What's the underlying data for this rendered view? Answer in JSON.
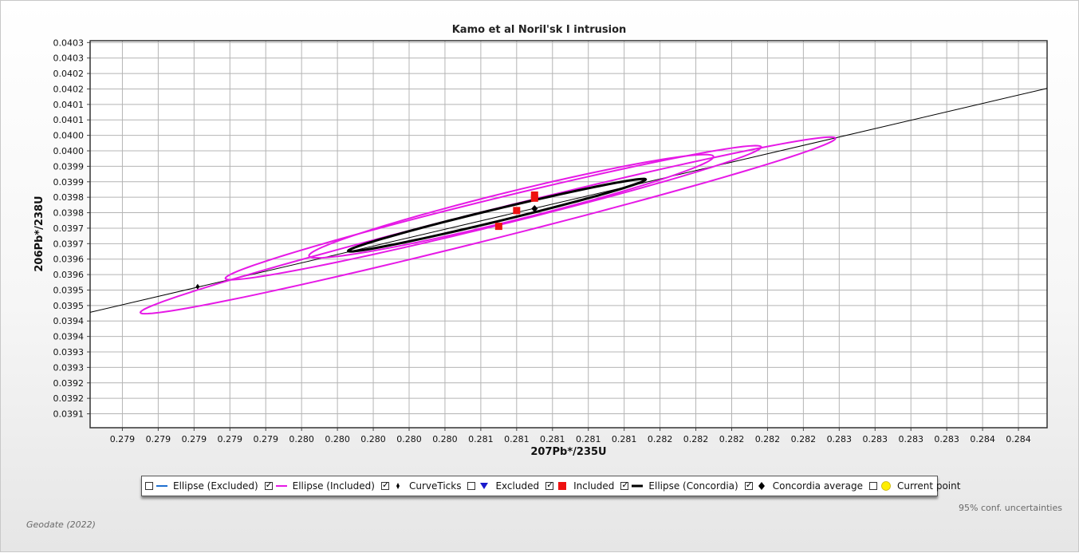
{
  "colors": {
    "ellipse_included": "#e619e6",
    "ellipse_excluded": "#1e6fd0",
    "ellipse_concordia": "#000000",
    "included_marker": "#ee1111",
    "excluded_marker": "#1a1acc",
    "current_point": "#ffee00",
    "concordia_line": "#000000",
    "grid": "#b4b4b4"
  },
  "chart_data": {
    "type": "scatter",
    "title": "Kamo et al Noril'sk I intrusion",
    "xlabel": "207Pb*/235U",
    "ylabel": "206Pb*/238U",
    "xlim": [
      0.27872,
      0.28406
    ],
    "ylim": [
      0.039065,
      0.040316
    ],
    "grid": true,
    "x_tick_values": [
      0.2789,
      0.2791,
      0.2793,
      0.2795,
      0.2797,
      0.2799,
      0.2801,
      0.2803,
      0.2805,
      0.2807,
      0.2809,
      0.2811,
      0.2813,
      0.2815,
      0.2817,
      0.2819,
      0.2821,
      0.2823,
      0.2825,
      0.2827,
      0.2829,
      0.2831,
      0.2833,
      0.2835,
      0.2837,
      0.2839
    ],
    "x_tick_labels": [
      "0.279",
      "0.279",
      "0.279",
      "0.279",
      "0.279",
      "0.280",
      "0.280",
      "0.280",
      "0.280",
      "0.280",
      "0.281",
      "0.281",
      "0.281",
      "0.281",
      "0.281",
      "0.282",
      "0.282",
      "0.282",
      "0.282",
      "0.282",
      "0.283",
      "0.283",
      "0.283",
      "0.283",
      "0.284",
      "0.284"
    ],
    "y_tick_values": [
      0.03911,
      0.03916,
      0.03921,
      0.03926,
      0.03931,
      0.03936,
      0.03941,
      0.03946,
      0.03951,
      0.03956,
      0.03961,
      0.03966,
      0.03971,
      0.03976,
      0.03981,
      0.03986,
      0.03991,
      0.03996,
      0.04001,
      0.04006,
      0.04011,
      0.04016,
      0.04021,
      0.04026,
      0.04031
    ],
    "y_tick_labels": [
      "0.0391",
      "0.0392",
      "0.0392",
      "0.0393",
      "0.0393",
      "0.0394",
      "0.0394",
      "0.0395",
      "0.0395",
      "0.0396",
      "0.0396",
      "0.0397",
      "0.0397",
      "0.0398",
      "0.0398",
      "0.0399",
      "0.0399",
      "0.0400",
      "0.0400",
      "0.0401",
      "0.0401",
      "0.0402",
      "0.0402",
      "0.0403",
      "0.0403"
    ],
    "concordia_line": {
      "x": [
        0.27872,
        0.28406
      ],
      "y": [
        0.039438,
        0.040162
      ]
    },
    "curve_ticks": [
      {
        "x": 0.27932,
        "y": 0.039521
      }
    ],
    "included_ellipses": [
      {
        "center": [
          0.28094,
          0.039719
        ],
        "semi_major": 0.00196,
        "semi_minor": 4.75e-05,
        "slope": 0.1452
      },
      {
        "center": [
          0.28097,
          0.03976
        ],
        "semi_major": 0.00151,
        "semi_minor": 4.4e-05,
        "slope": 0.142
      },
      {
        "center": [
          0.28107,
          0.039781
        ],
        "semi_major": 0.00114,
        "semi_minor": 4.75e-05,
        "slope": 0.142
      }
    ],
    "concordia_ellipse": {
      "center": [
        0.28099,
        0.039752
      ],
      "semi_major": 0.000838,
      "semi_minor": 2.02e-05,
      "slope": 0.1393
    },
    "included_points": [
      {
        "x": 0.281,
        "y": 0.039716
      },
      {
        "x": 0.2811,
        "y": 0.039767
      },
      {
        "x": 0.2812,
        "y": 0.039817
      },
      {
        "x": 0.2812,
        "y": 0.039807
      }
    ],
    "concordia_average": {
      "x": 0.2812,
      "y": 0.039773
    }
  },
  "legend": {
    "items": [
      {
        "label": "Ellipse (Excluded)",
        "checked": false,
        "symbol": "line-blue"
      },
      {
        "label": "Ellipse (Included)",
        "checked": true,
        "symbol": "line-magenta"
      },
      {
        "label": "CurveTicks",
        "checked": true,
        "symbol": "small-diamond"
      },
      {
        "label": "Excluded",
        "checked": false,
        "symbol": "triangle-down-blue"
      },
      {
        "label": "Included",
        "checked": true,
        "symbol": "square-red"
      },
      {
        "label": "Ellipse (Concordia)",
        "checked": true,
        "symbol": "line-black"
      },
      {
        "label": "Concordia average",
        "checked": true,
        "symbol": "diamond-black"
      },
      {
        "label": "Current point",
        "checked": false,
        "symbol": "circle-yellow"
      }
    ]
  },
  "footer": {
    "uncertainty_note": "95% conf. uncertainties",
    "credit": "Geodate (2022)"
  }
}
